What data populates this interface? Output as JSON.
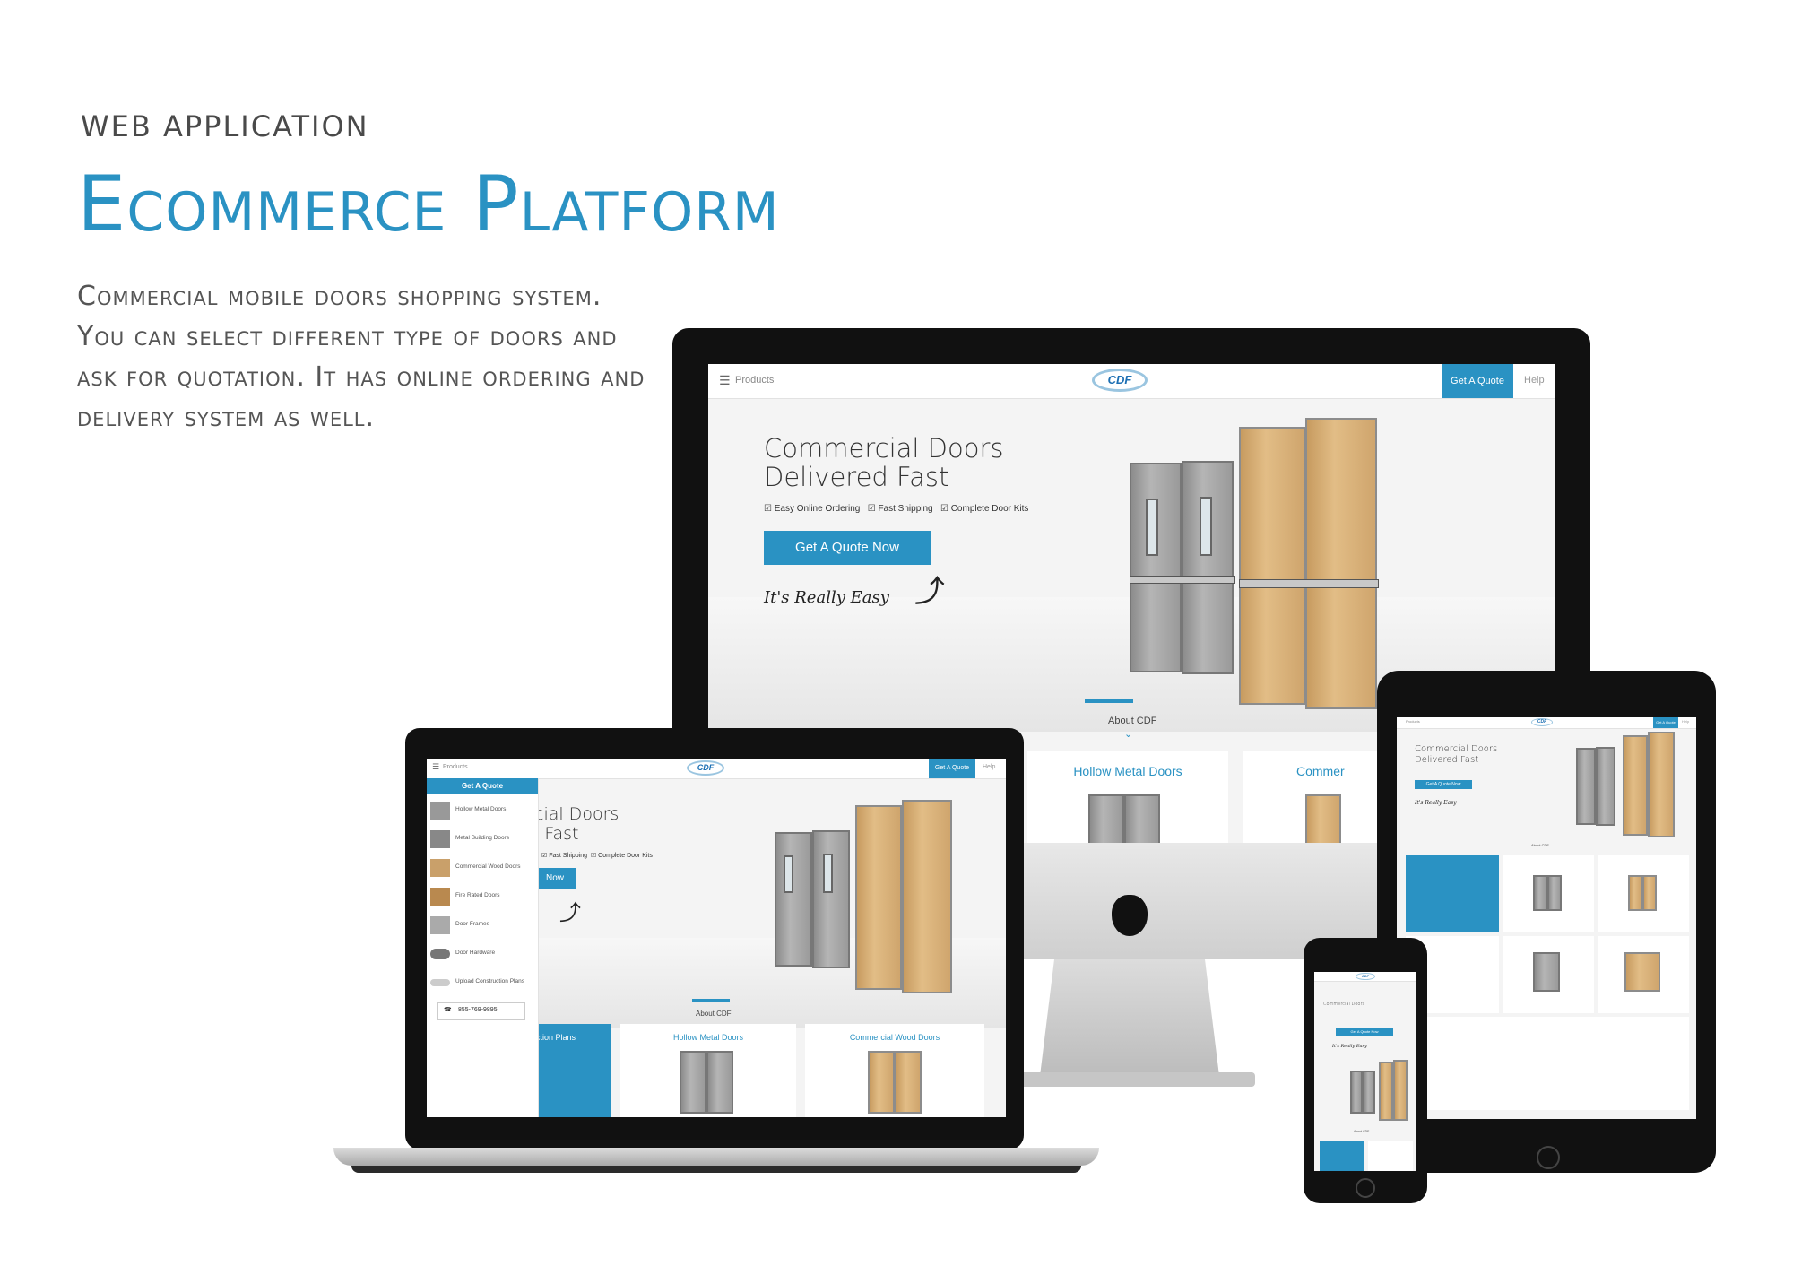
{
  "page": {
    "eyebrow": "WEB APPLICATION",
    "headline": "Ecommerce Platform",
    "description": "Commercial mobile doors shopping system. You can select different type of doors and ask for quotation. It has online ordering and delivery system as well."
  },
  "site": {
    "logo_text": "CDF",
    "nav": {
      "products_label": "Products",
      "get_quote_label": "Get A Quote",
      "help_label": "Help"
    },
    "hero": {
      "title_line1": "Commercial Doors",
      "title_line2": "Delivered Fast",
      "features": [
        "Easy Online Ordering",
        "Fast Shipping",
        "Complete Door Kits"
      ],
      "cta_label": "Get A Quote Now",
      "tagline": "It's Really Easy"
    },
    "about_label": "About CDF",
    "cards": [
      "Hollow Metal Doors",
      "Commercial Wood Doors"
    ]
  },
  "laptop": {
    "hero_title_line1_partial": "cial Doors",
    "hero_title_line2_partial": "l Fast",
    "features_partial": [
      "Fast Shipping",
      "Complete Door Kits"
    ],
    "cta_partial": "Now",
    "menu_header": "Get A Quote",
    "menu_items": [
      "Hollow Metal Doors",
      "Metal Building Doors",
      "Commercial Wood Doors",
      "Fire Rated Doors",
      "Door Frames",
      "Door Hardware",
      "Upload Construction Plans"
    ],
    "phone": "855-769-9895",
    "partial_card": "ction Plans"
  },
  "desktop": {
    "partial_card": "Commer"
  },
  "colors": {
    "accent": "#2a92c3",
    "device_black": "#111111"
  }
}
